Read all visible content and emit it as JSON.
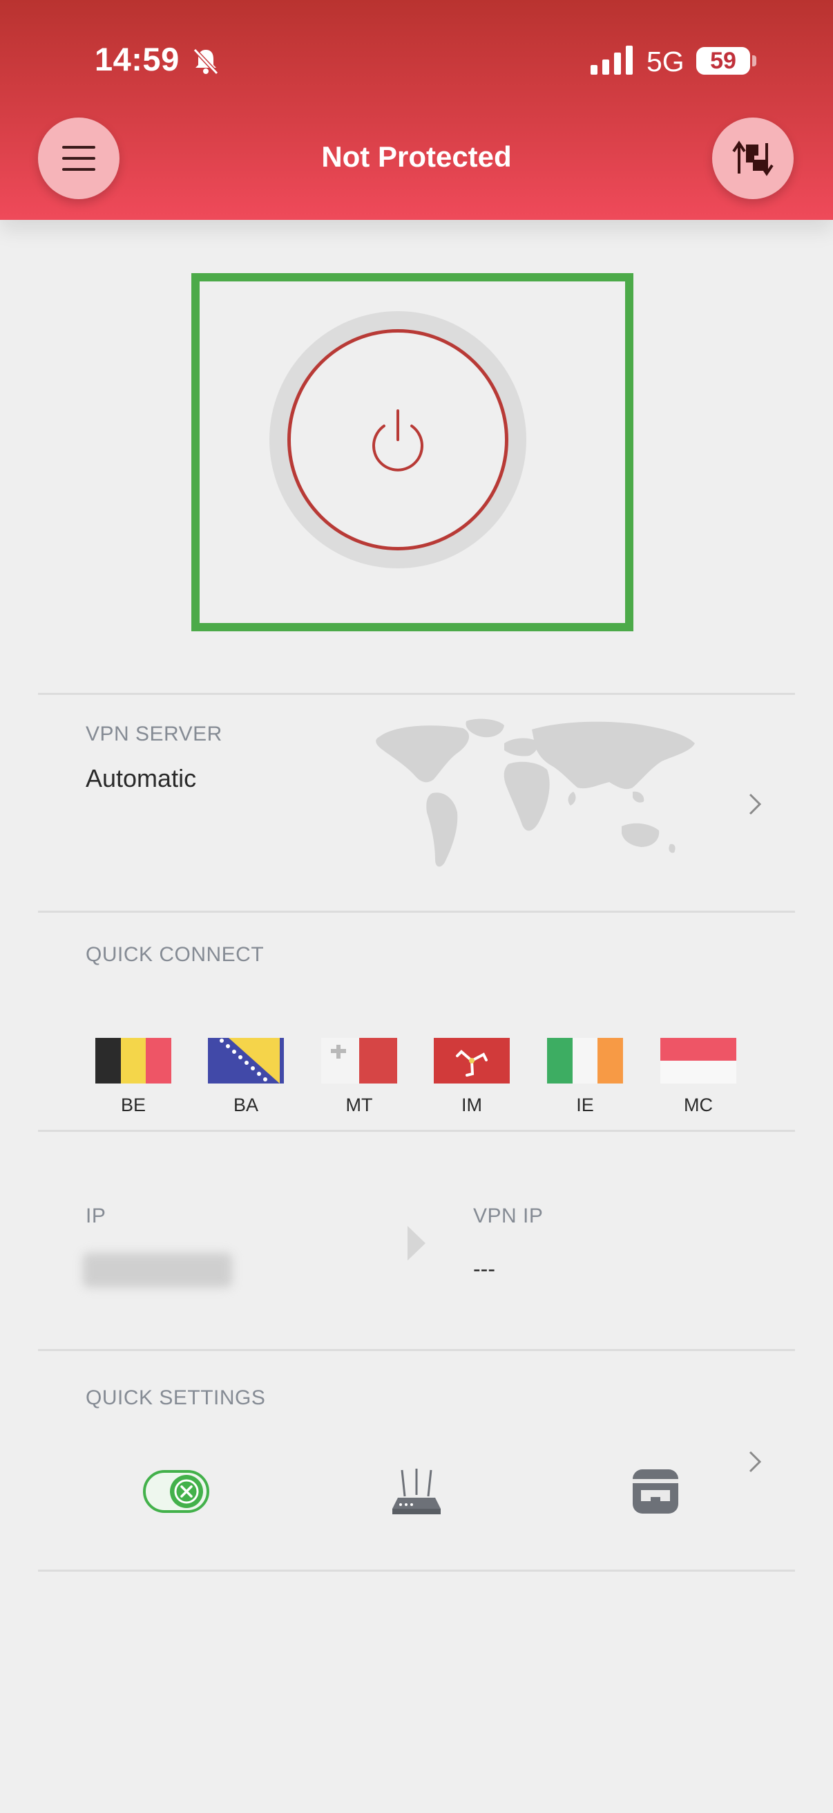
{
  "status_bar": {
    "time": "14:59",
    "network": "5G",
    "battery": "59"
  },
  "header": {
    "title": "Not Protected"
  },
  "icons": {
    "menu": "hamburger-menu-icon",
    "switch": "swap-servers-icon",
    "power": "power-icon",
    "map": "world-map-icon",
    "qs_killswitch": "kill-switch-toggle-icon",
    "qs_router": "router-icon",
    "qs_adblock": "ad-block-icon"
  },
  "colors": {
    "header_top": "#b93330",
    "header_bottom": "#ef4a5a",
    "power_ring": "#b83a36",
    "highlight": "#4caa49",
    "toggle_green": "#43b14b"
  },
  "vpn_server": {
    "label": "VPN SERVER",
    "value": "Automatic"
  },
  "quick_connect": {
    "label": "QUICK CONNECT",
    "countries": [
      "BE",
      "BA",
      "MT",
      "IM",
      "IE",
      "MC"
    ]
  },
  "ip_section": {
    "ip_label": "IP",
    "vpn_ip_label": "VPN IP",
    "vpn_ip_value": "---"
  },
  "quick_settings": {
    "label": "QUICK SETTINGS"
  }
}
